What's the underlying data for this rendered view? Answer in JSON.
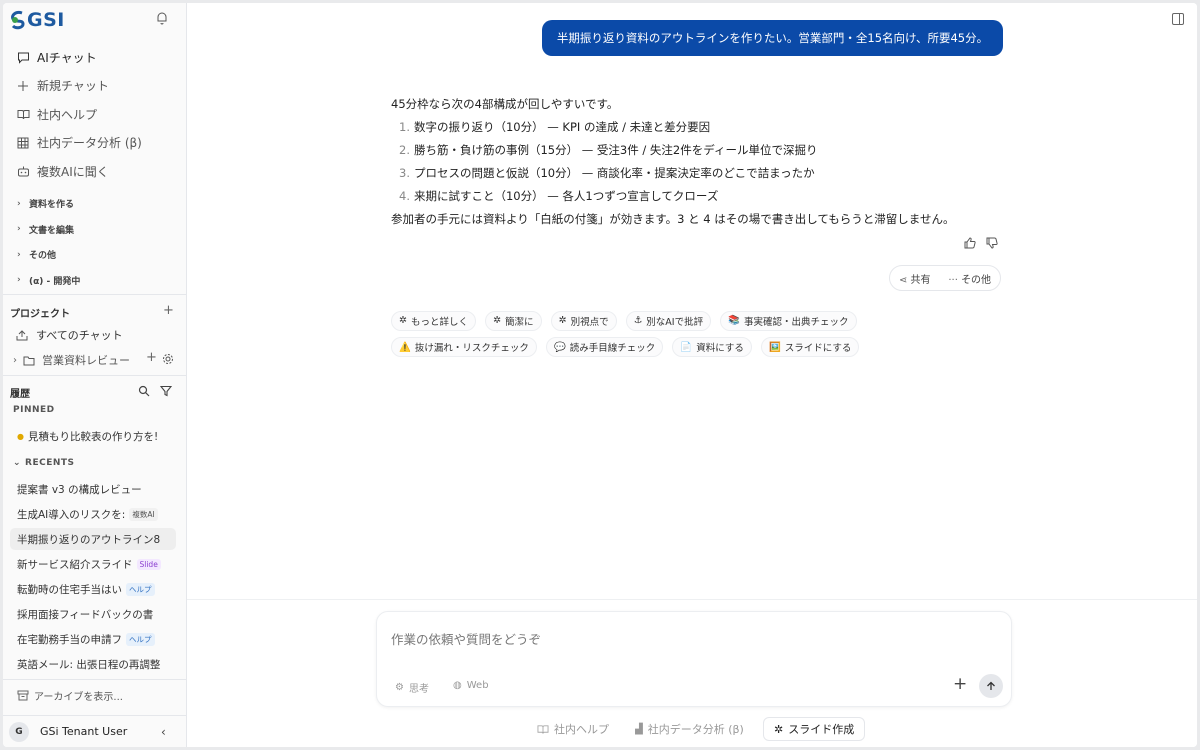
{
  "logo": {
    "text": "GSI"
  },
  "nav": [
    {
      "label": "AIチャット",
      "icon": "chat-icon"
    },
    {
      "label": "新規チャット",
      "icon": "plus-icon"
    },
    {
      "label": "社内ヘルプ",
      "icon": "book-icon"
    },
    {
      "label": "社内データ分析 (β)",
      "icon": "table-icon"
    },
    {
      "label": "複数AIに聞く",
      "icon": "bot-icon"
    }
  ],
  "groups": [
    "資料を作る",
    "文書を編集",
    "その他",
    "(α) - 開発中"
  ],
  "projects": {
    "title": "プロジェクト",
    "all_chats": "すべてのチャット",
    "folder": "営業資料レビュー"
  },
  "history": {
    "title": "履歴",
    "pinned_label": "PINNED",
    "pinned_item": "見積もり比較表の作り方を!",
    "recents_label": "RECENTS",
    "items": [
      {
        "label": "提案書 v3 の構成レビュー",
        "tag": ""
      },
      {
        "label": "生成AI導入のリスクを:",
        "tag": "複数AI"
      },
      {
        "label": "半期振り返りのアウトライン8",
        "tag": ""
      },
      {
        "label": "新サービス紹介スライド",
        "tag": "Slide"
      },
      {
        "label": "転勤時の住宅手当はい",
        "tag": "ヘルプ"
      },
      {
        "label": "採用面接フィードバックの書",
        "tag": ""
      },
      {
        "label": "在宅勤務手当の申請フ",
        "tag": "ヘルプ"
      },
      {
        "label": "英語メール: 出張日程の再調整",
        "tag": ""
      }
    ],
    "archive": "アーカイブを表示..."
  },
  "user": {
    "initial": "G",
    "name": "GSi Tenant User"
  },
  "conversation": {
    "user_message": "半期振り返り資料のアウトラインを作りたい。営業部門・全15名向け、所要45分。",
    "intro": "45分枠なら次の4部構成が回しやすいです。",
    "list": [
      {
        "num": "1.",
        "text": "数字の振り返り（10分） — KPI の達成 / 未達と差分要因"
      },
      {
        "num": "2.",
        "text": "勝ち筋・負け筋の事例（15分） — 受注3件 / 失注2件をディール単位で深掘り"
      },
      {
        "num": "3.",
        "text": "プロセスの問題と仮説（10分） — 商談化率・提案決定率のどこで詰まったか"
      },
      {
        "num": "4.",
        "text": "来期に試すこと（10分） — 各人1つずつ宣言してクローズ"
      }
    ],
    "closing": "参加者の手元には資料より「白紙の付箋」が効きます。3 と 4 はその場で書き出してもらうと滞留しません。",
    "share": "共有",
    "more": "その他"
  },
  "chips": [
    {
      "icon": "✲",
      "label": "もっと詳しく"
    },
    {
      "icon": "✲",
      "label": "簡潔に"
    },
    {
      "icon": "✲",
      "label": "別視点で"
    },
    {
      "icon": "⚓",
      "label": "別なAIで批評"
    },
    {
      "icon": "📚",
      "label": "事実確認・出典チェック"
    },
    {
      "icon": "⚠️",
      "label": "抜け漏れ・リスクチェック"
    },
    {
      "icon": "💬",
      "label": "読み手目線チェック"
    },
    {
      "icon": "📄",
      "label": "資料にする"
    },
    {
      "icon": "🖼️",
      "label": "スライドにする"
    }
  ],
  "composer": {
    "placeholder": "作業の依頼や質問をどうぞ",
    "think": "思考",
    "web": "Web"
  },
  "tools": [
    {
      "label": "社内ヘルプ"
    },
    {
      "label": "社内データ分析 (β)"
    },
    {
      "label": "スライド作成"
    }
  ],
  "colors": {
    "brand": "#1e5aa0",
    "bubble": "#0b4aa8"
  }
}
